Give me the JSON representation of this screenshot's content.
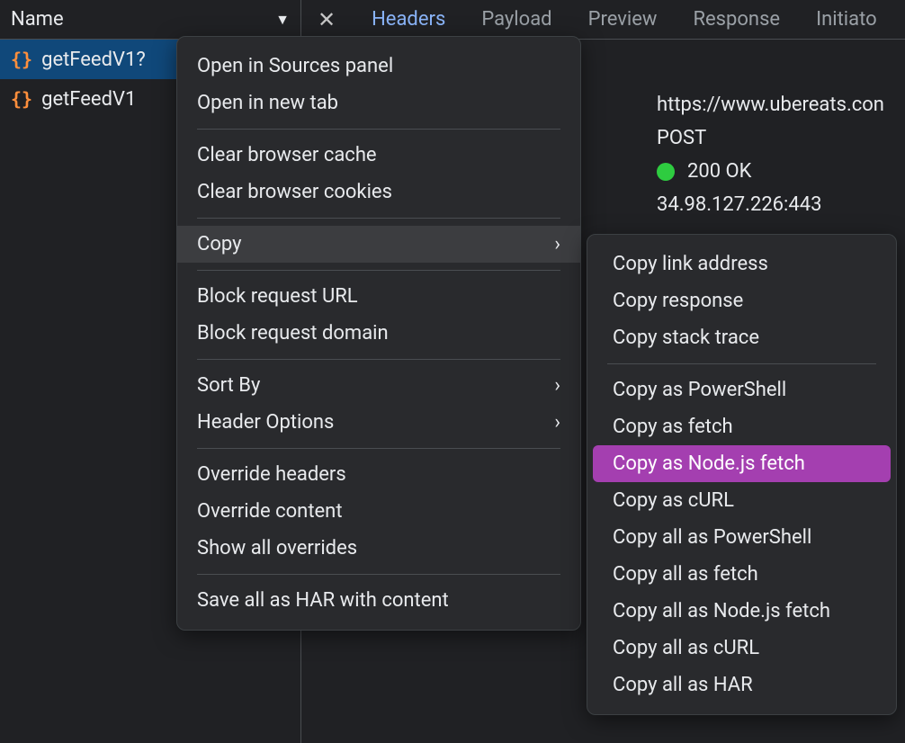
{
  "leftPanel": {
    "header": "Name",
    "requests": [
      {
        "name": "getFeedV1?"
      },
      {
        "name": "getFeedV1"
      }
    ]
  },
  "tabs": {
    "items": [
      "Headers",
      "Payload",
      "Preview",
      "Response",
      "Initiato"
    ],
    "activeIndex": 0
  },
  "headers": {
    "url": "https://www.ubereats.con",
    "method": "POST",
    "status": "200 OK",
    "remote": "34.98.127.226:443"
  },
  "contextMenu": {
    "group1": [
      "Open in Sources panel",
      "Open in new tab"
    ],
    "group2": [
      "Clear browser cache",
      "Clear browser cookies"
    ],
    "copyLabel": "Copy",
    "group3": [
      "Block request URL",
      "Block request domain"
    ],
    "sortByLabel": "Sort By",
    "headerOptionsLabel": "Header Options",
    "group4": [
      "Override headers",
      "Override content",
      "Show all overrides"
    ],
    "group5": [
      "Save all as HAR with content"
    ]
  },
  "copySubmenu": {
    "group1": [
      "Copy link address",
      "Copy response",
      "Copy stack trace"
    ],
    "group2": [
      "Copy as PowerShell",
      "Copy as fetch",
      "Copy as Node.js fetch",
      "Copy as cURL",
      "Copy all as PowerShell",
      "Copy all as fetch",
      "Copy all as Node.js fetch",
      "Copy all as cURL",
      "Copy all as HAR"
    ],
    "highlightIndex": 2
  }
}
